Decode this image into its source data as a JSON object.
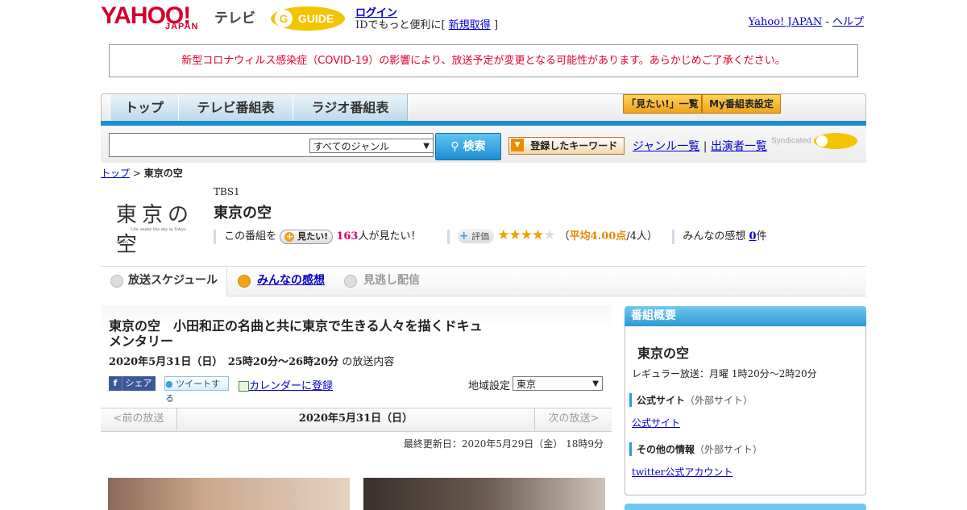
{
  "header": {
    "logo_yahoo": "YAHOO!",
    "logo_japan": "JAPAN",
    "logo_tv": "テレビ",
    "logo_gguide": "GUIDE",
    "login": "ログイン",
    "login_sub_prefix": "IDでもっと便利に[",
    "register": "新規取得",
    "login_sub_suffix": "]",
    "yahoo_japan": "Yahoo! JAPAN",
    "separator": "-",
    "help": "ヘルプ"
  },
  "notice": "新型コロナウィルス感染症（COVID-19）の影響により、放送予定が変更となる可能性があります。あらかじめご了承ください。",
  "nav": {
    "tabs": [
      "トップ",
      "テレビ番組表",
      "ラジオ番組表"
    ],
    "mitai_list": "「見たい!」一覧",
    "my_settings": "My番組表設定"
  },
  "search": {
    "genre": "すべてのジャンル",
    "button": "検索",
    "keyword_button": "登録したキーワード",
    "genre_list": "ジャンル一覧",
    "pipe": "|",
    "cast_list": "出演者一覧",
    "syndicated": "Syndicated"
  },
  "breadcrumb": {
    "top": "トップ",
    "sep": ">",
    "current": "東京の空"
  },
  "program": {
    "thumb_title": "東京の空",
    "thumb_sub": "Life under the sky in Tokyo",
    "thumb_copy": "©TBS",
    "station": "TBS1",
    "title": "東京の空",
    "mitai_prefix": "この番組を",
    "mitai_button": "見たい!",
    "mitai_count": "163",
    "mitai_suffix": "人が見たい！",
    "rating_label": "評価",
    "stars": "★★★★",
    "star_empty": "★",
    "rating_open": "（",
    "rating_avg": "平均4.00点",
    "rating_people": "/4人）",
    "impressions_label": "みんなの感想",
    "impressions_count": "0",
    "impressions_suffix": "件",
    "rating_value": 4,
    "rating_max": 5
  },
  "content_tabs": [
    "放送スケジュール",
    "みんなの感想",
    "見逃し配信"
  ],
  "episode": {
    "title": "東京の空　小田和正の名曲と共に東京で生きる人々を描くドキュメンタリー",
    "date": "2020年5月31日（日）　25時20分～26時20分",
    "date_suffix": "の放送内容",
    "share_fb": "シェア",
    "share_tw": "ツイートする",
    "calendar": "カレンダーに登録",
    "region_label": "地域設定",
    "region": "東京",
    "prev": "<前の放送",
    "current_date": "2020年5月31日（日）",
    "next": "次の放送>",
    "updated": "最終更新日：2020年5月29日（金） 18時9分"
  },
  "sidebar": {
    "heading": "番組概要",
    "title": "東京の空",
    "regular": "レギュラー放送：月曜 1時20分～2時20分",
    "official_label": "公式サイト",
    "official_sub": "（外部サイト）",
    "official_link": "公式サイト",
    "other_label": "その他の情報",
    "other_sub": "（外部サイト）",
    "twitter_link": "twitter公式アカウント"
  },
  "colors": {
    "brand_red": "#d4002a",
    "accent_blue": "#1d8fcf",
    "notice_red": "#e4002b",
    "mitai_pink": "#d6006f",
    "rating_orange": "#e48a00"
  }
}
